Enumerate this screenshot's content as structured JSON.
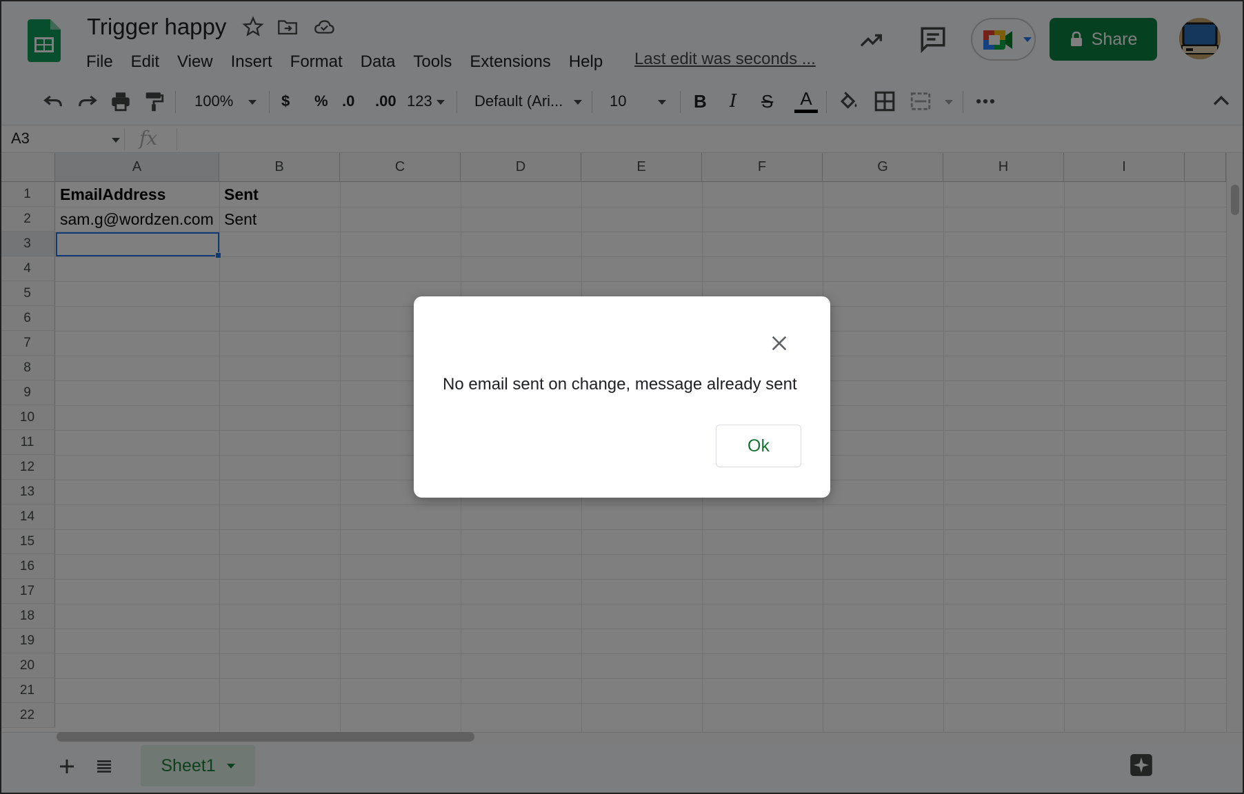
{
  "app": {
    "doc_title": "Trigger happy",
    "last_edit": "Last edit was seconds ...",
    "share_label": "Share"
  },
  "menu": [
    "File",
    "Edit",
    "View",
    "Insert",
    "Format",
    "Data",
    "Tools",
    "Extensions",
    "Help"
  ],
  "toolbar": {
    "zoom": "100%",
    "currency": "$",
    "percent": "%",
    "decrease_decimal": ".0",
    "increase_decimal": ".00",
    "number_format": "123",
    "font": "Default (Ari...",
    "font_size": "10",
    "bold": "B",
    "italic": "I",
    "strikethrough": "S",
    "text_color": "A"
  },
  "formula_bar": {
    "name_box": "A3",
    "fx": "fx",
    "value": ""
  },
  "grid": {
    "columns": [
      "A",
      "B",
      "C",
      "D",
      "E",
      "F",
      "G",
      "H",
      "I"
    ],
    "rows": [
      "1",
      "2",
      "3",
      "4",
      "5",
      "6",
      "7",
      "8",
      "9",
      "10",
      "11",
      "12",
      "13",
      "14",
      "15",
      "16",
      "17",
      "18",
      "19",
      "20",
      "21",
      "22"
    ],
    "cells": {
      "A1": "EmailAddress",
      "B1": "Sent",
      "A2": "sam.g@wordzen.com",
      "B2": "Sent"
    },
    "selected_cell": "A3"
  },
  "sheets": {
    "active": "Sheet1"
  },
  "dialog": {
    "message": "No email sent on change, message already sent",
    "ok_label": "Ok"
  },
  "colors": {
    "share_green": "#0b8043",
    "selection_blue": "#1a73e8",
    "ok_text": "#137333"
  }
}
